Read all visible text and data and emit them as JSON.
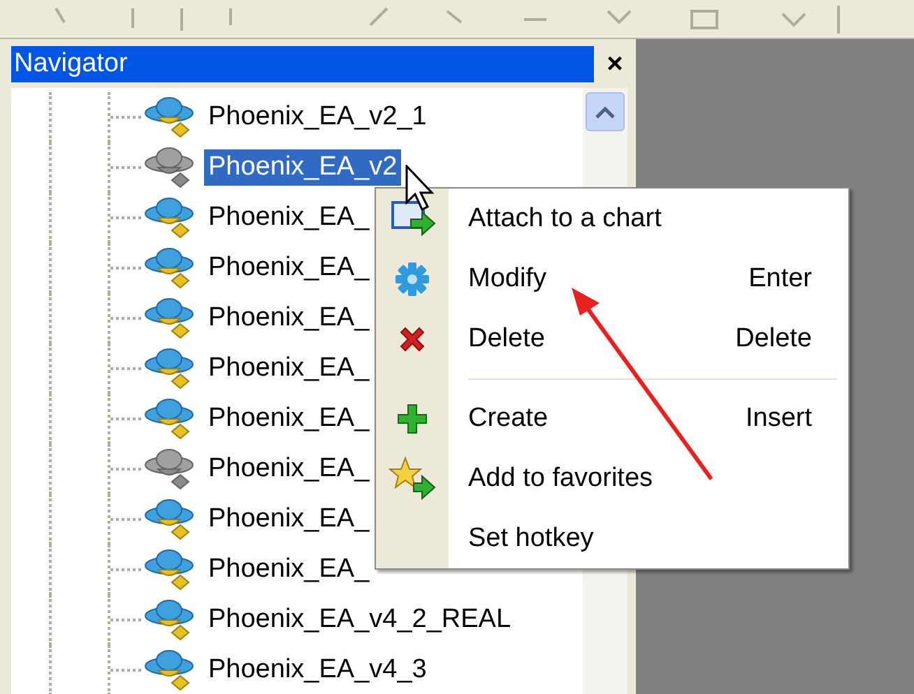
{
  "navigator": {
    "title": "Navigator",
    "close": "×",
    "items": [
      {
        "label": "Phoenix_EA_v2_1",
        "disabled": false,
        "selected": false
      },
      {
        "label": "Phoenix_EA_v2",
        "disabled": true,
        "selected": true
      },
      {
        "label": "Phoenix_EA_",
        "disabled": false,
        "selected": false
      },
      {
        "label": "Phoenix_EA_",
        "disabled": false,
        "selected": false
      },
      {
        "label": "Phoenix_EA_",
        "disabled": false,
        "selected": false
      },
      {
        "label": "Phoenix_EA_",
        "disabled": false,
        "selected": false
      },
      {
        "label": "Phoenix_EA_",
        "disabled": false,
        "selected": false
      },
      {
        "label": "Phoenix_EA_",
        "disabled": true,
        "selected": false
      },
      {
        "label": "Phoenix_EA_",
        "disabled": false,
        "selected": false
      },
      {
        "label": "Phoenix_EA_",
        "disabled": false,
        "selected": false
      },
      {
        "label": "Phoenix_EA_v4_2_REAL",
        "disabled": false,
        "selected": false
      },
      {
        "label": "Phoenix_EA_v4_3",
        "disabled": false,
        "selected": false
      }
    ]
  },
  "context_menu": [
    {
      "kind": "item",
      "label": "Attach to a chart"
    },
    {
      "kind": "item",
      "label": "Modify",
      "shortcut": "Enter"
    },
    {
      "kind": "item",
      "label": "Delete",
      "shortcut": "Delete"
    },
    {
      "kind": "separator"
    },
    {
      "kind": "item",
      "label": "Create",
      "shortcut": "Insert"
    },
    {
      "kind": "item",
      "label": "Add to favorites"
    },
    {
      "kind": "item",
      "label": "Set hotkey"
    }
  ]
}
